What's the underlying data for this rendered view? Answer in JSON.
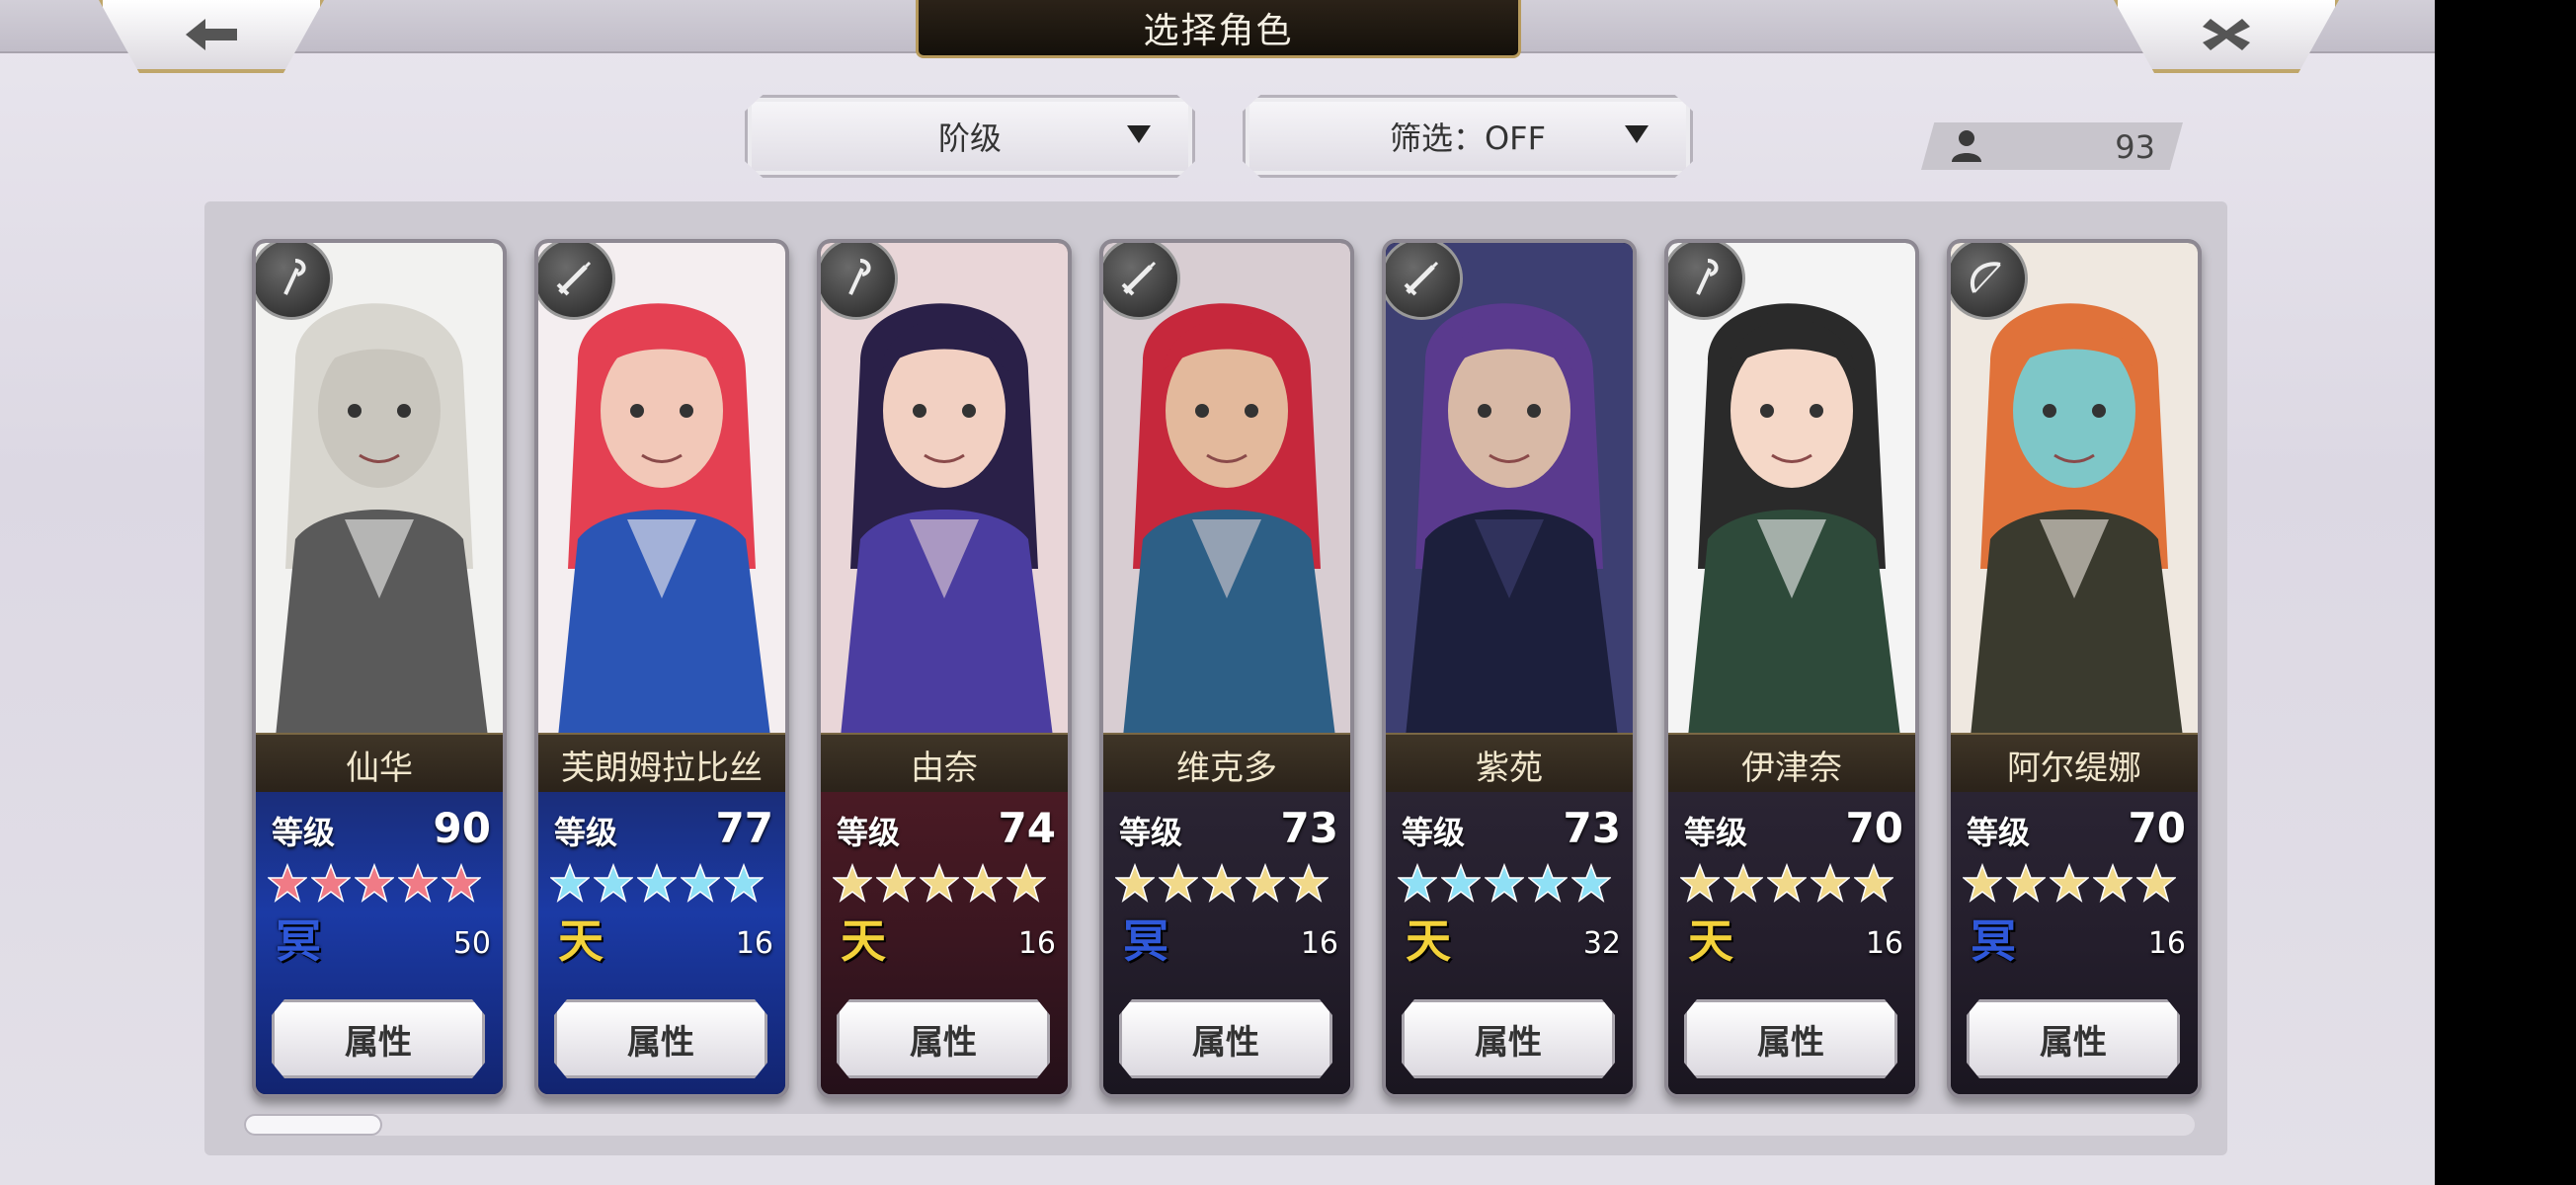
{
  "header": {
    "title": "选择角色"
  },
  "filters": {
    "sort_label": "阶级",
    "filter_label": "筛选：OFF"
  },
  "roster_count": "93",
  "colors": {
    "star_pink": "#f07b86",
    "star_cyan": "#8fe0f5",
    "star_gold": "#f1d98a",
    "tier_gold": "#f3d23a",
    "tier_blue": "#2f58d9"
  },
  "cards": [
    {
      "name": "仙华",
      "level_label": "等级",
      "level": "90",
      "stars": 5,
      "star_color": "pink",
      "tier_icon": "冥",
      "tier_color": "blue",
      "count": "50",
      "attr_label": "属性",
      "weapon": "staff-icon",
      "bg": "blue"
    },
    {
      "name": "芙朗姆拉比丝",
      "level_label": "等级",
      "level": "77",
      "stars": 5,
      "star_color": "cyan",
      "tier_icon": "天",
      "tier_color": "gold",
      "count": "16",
      "attr_label": "属性",
      "weapon": "sword-icon",
      "bg": "blue"
    },
    {
      "name": "由奈",
      "level_label": "等级",
      "level": "74",
      "stars": 5,
      "star_color": "gold",
      "tier_icon": "天",
      "tier_color": "gold",
      "count": "16",
      "attr_label": "属性",
      "weapon": "staff-icon",
      "bg": "red"
    },
    {
      "name": "维克多",
      "level_label": "等级",
      "level": "73",
      "stars": 5,
      "star_color": "gold",
      "tier_icon": "冥",
      "tier_color": "blue",
      "count": "16",
      "attr_label": "属性",
      "weapon": "sword-icon",
      "bg": "dark"
    },
    {
      "name": "紫苑",
      "level_label": "等级",
      "level": "73",
      "stars": 5,
      "star_color": "cyan",
      "tier_icon": "天",
      "tier_color": "gold",
      "count": "32",
      "attr_label": "属性",
      "weapon": "sword-icon",
      "bg": "dark"
    },
    {
      "name": "伊津奈",
      "level_label": "等级",
      "level": "70",
      "stars": 5,
      "star_color": "gold",
      "tier_icon": "天",
      "tier_color": "gold",
      "count": "16",
      "attr_label": "属性",
      "weapon": "staff-icon",
      "bg": "dark"
    },
    {
      "name": "阿尔缇娜",
      "level_label": "等级",
      "level": "70",
      "stars": 5,
      "star_color": "gold",
      "tier_icon": "冥",
      "tier_color": "blue",
      "count": "16",
      "attr_label": "属性",
      "weapon": "bow-icon",
      "bg": "dark"
    }
  ]
}
